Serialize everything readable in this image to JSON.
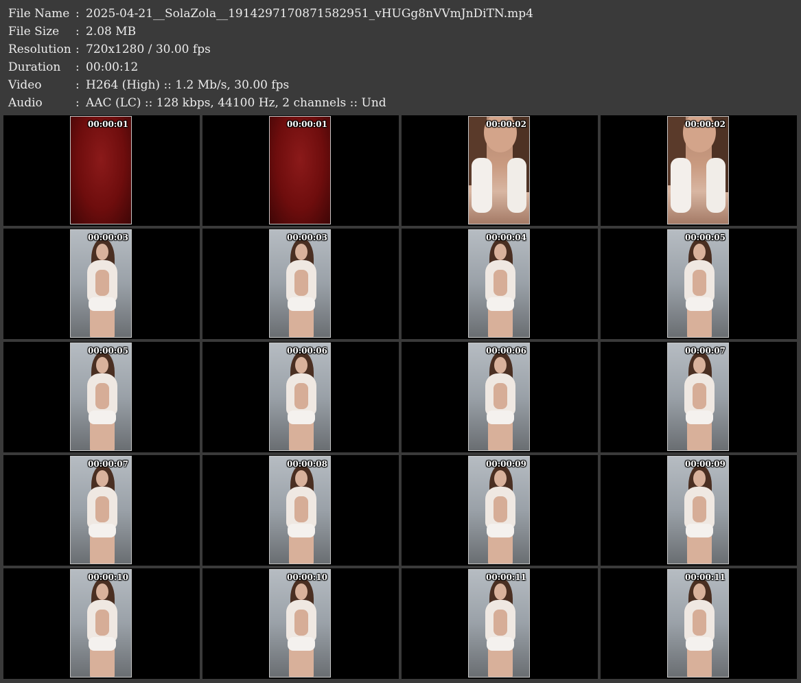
{
  "info": {
    "file_name": {
      "label": "File Name",
      "value": "2025-04-21__SolaZola__1914297170871582951_vHUGg8nVVmJnDiTN.mp4"
    },
    "file_size": {
      "label": "File Size",
      "value": "2.08 MB"
    },
    "resolution": {
      "label": "Resolution",
      "value": "720x1280 / 30.00 fps"
    },
    "duration": {
      "label": "Duration",
      "value": "00:00:12"
    },
    "video": {
      "label": "Video",
      "value": "H264 (High) :: 1.2 Mb/s, 30.00 fps"
    },
    "audio": {
      "label": "Audio",
      "value": "AAC (LC) :: 128 kbps, 44100 Hz, 2 channels :: Und"
    },
    "separator": ":"
  },
  "thumbnails": [
    {
      "time": "00:00:01",
      "scene": "red"
    },
    {
      "time": "00:00:01",
      "scene": "red"
    },
    {
      "time": "00:00:02",
      "scene": "closeup"
    },
    {
      "time": "00:00:02",
      "scene": "closeup"
    },
    {
      "time": "00:00:03",
      "scene": "body"
    },
    {
      "time": "00:00:03",
      "scene": "body"
    },
    {
      "time": "00:00:04",
      "scene": "body"
    },
    {
      "time": "00:00:05",
      "scene": "body"
    },
    {
      "time": "00:00:05",
      "scene": "body"
    },
    {
      "time": "00:00:06",
      "scene": "body"
    },
    {
      "time": "00:00:06",
      "scene": "body"
    },
    {
      "time": "00:00:07",
      "scene": "body"
    },
    {
      "time": "00:00:07",
      "scene": "body"
    },
    {
      "time": "00:00:08",
      "scene": "body"
    },
    {
      "time": "00:00:09",
      "scene": "body"
    },
    {
      "time": "00:00:09",
      "scene": "body"
    },
    {
      "time": "00:00:10",
      "scene": "body"
    },
    {
      "time": "00:00:10",
      "scene": "body"
    },
    {
      "time": "00:00:11",
      "scene": "body"
    },
    {
      "time": "00:00:11",
      "scene": "body"
    }
  ]
}
